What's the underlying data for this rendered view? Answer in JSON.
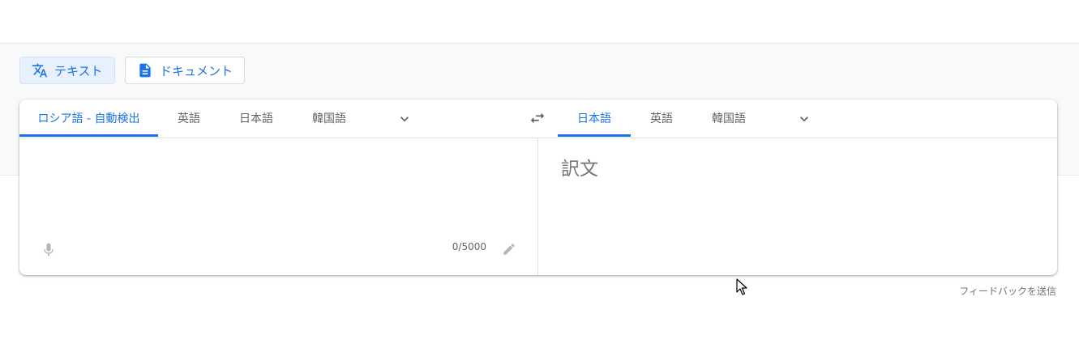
{
  "mode_buttons": {
    "text_label": "テキスト",
    "document_label": "ドキュメント"
  },
  "source_languages": {
    "tabs": [
      {
        "label": "ロシア語 - 自動検出",
        "active": true
      },
      {
        "label": "英語",
        "active": false
      },
      {
        "label": "日本語",
        "active": false
      },
      {
        "label": "韓国語",
        "active": false
      }
    ]
  },
  "target_languages": {
    "tabs": [
      {
        "label": "日本語",
        "active": true
      },
      {
        "label": "英語",
        "active": false
      },
      {
        "label": "韓国語",
        "active": false
      }
    ]
  },
  "source": {
    "value": "",
    "char_count": "0/5000"
  },
  "target": {
    "placeholder": "訳文"
  },
  "footer": {
    "feedback_label": "フィードバックを送信"
  },
  "icons": {
    "text_mode": "translate-icon",
    "document_mode": "document-icon",
    "more_source": "chevron-down-icon",
    "swap": "swap-icon",
    "more_target": "chevron-down-icon",
    "mic": "microphone-icon",
    "handwriting": "pencil-icon"
  },
  "colors": {
    "accent": "#1a73e8",
    "active_mode_bg": "#e8f0fe"
  }
}
